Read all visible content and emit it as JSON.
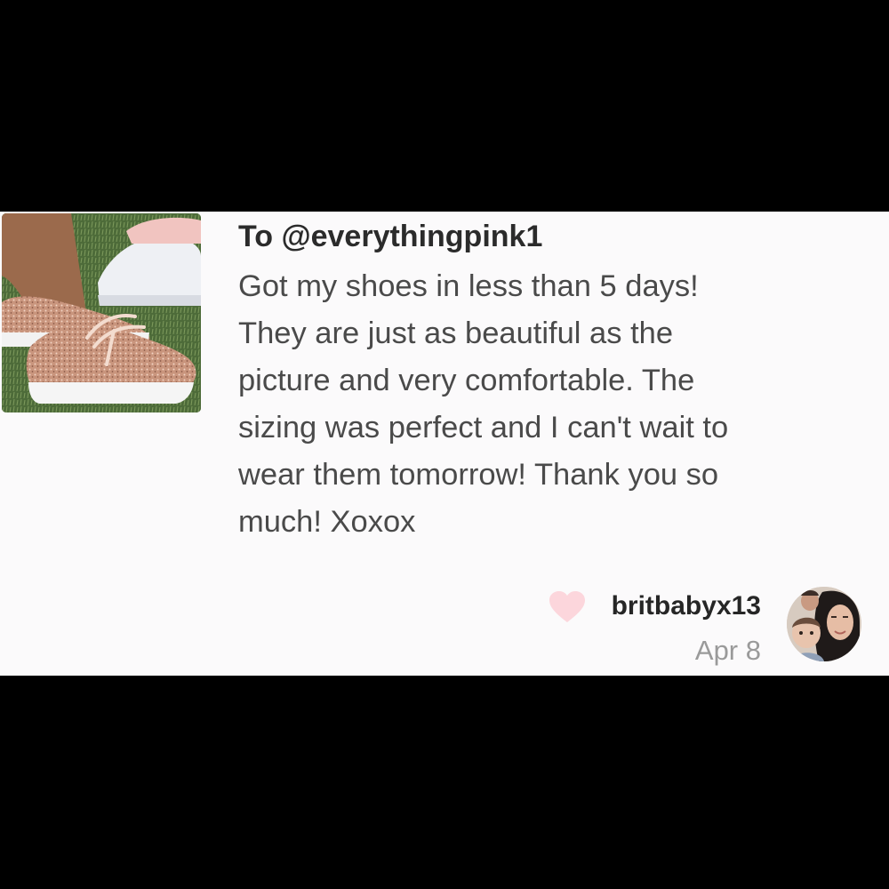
{
  "review": {
    "recipient": "To @everythingpink1",
    "message": "Got my shoes in less than 5 days!\nThey are just as beautiful as the\npicture and very comfortable. The\nsizing was perfect and I can't wait to\nwear them tomorrow! Thank you so\nmuch! Xoxox",
    "author": "britbabyx13",
    "date": "Apr 8",
    "product_image_icon": "glitter-sneakers-photo",
    "like_icon": "heart-icon",
    "avatar_icon": "user-avatar-photo"
  },
  "colors": {
    "heart": "#fcd6dc",
    "card_background": "#fbfafb",
    "frame": "#000000",
    "date_text": "#9a9a9a"
  }
}
